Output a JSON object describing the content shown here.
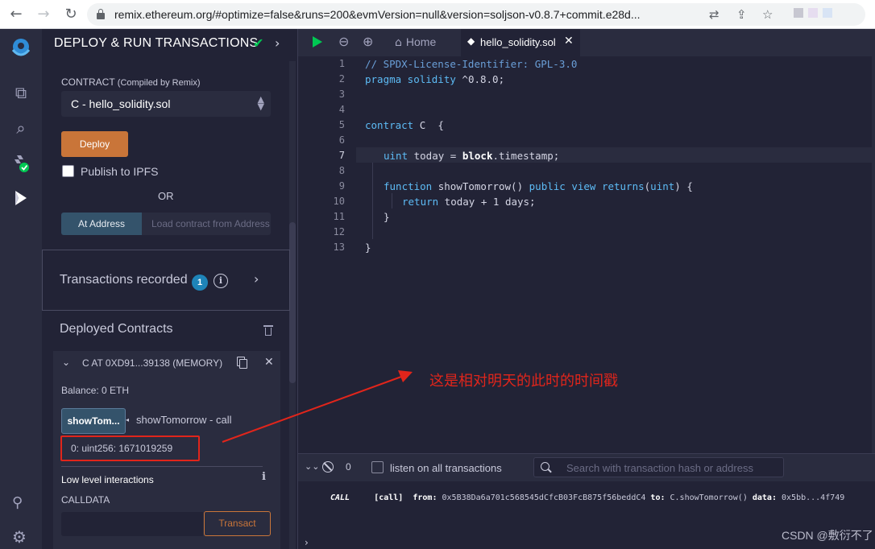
{
  "browser": {
    "url": "remix.ethereum.org/#optimize=false&runs=200&evmVersion=null&version=soljson-v0.8.7+commit.e28d..."
  },
  "panel": {
    "title": "DEPLOY & RUN TRANSACTIONS",
    "contract_label": "CONTRACT",
    "contract_sublabel": "(Compiled by Remix)",
    "contract_selected": "C - hello_solidity.sol",
    "deploy_label": "Deploy",
    "publish_label": "Publish to IPFS",
    "or_label": "OR",
    "at_address_label": "At Address",
    "at_address_placeholder": "Load contract from Address",
    "transactions_recorded_label": "Transactions recorded",
    "transactions_recorded_count": "1",
    "deployed_contracts_label": "Deployed Contracts",
    "instance": {
      "title": "C AT 0XD91...39138 (MEMORY)",
      "balance": "Balance: 0 ETH",
      "function_button": "showTom...",
      "function_label": "showTomorrow - call",
      "result": "0: uint256: 1671019259",
      "low_level_label": "Low level interactions",
      "calldata_label": "CALLDATA",
      "transact_label": "Transact"
    }
  },
  "editor": {
    "home_tab": "Home",
    "file_tab": "hello_solidity.sol",
    "lines": [
      {
        "n": "1"
      },
      {
        "n": "2"
      },
      {
        "n": "3"
      },
      {
        "n": "4"
      },
      {
        "n": "5"
      },
      {
        "n": "6"
      },
      {
        "n": "7"
      },
      {
        "n": "8"
      },
      {
        "n": "9"
      },
      {
        "n": "10"
      },
      {
        "n": "11"
      },
      {
        "n": "12"
      },
      {
        "n": "13"
      }
    ],
    "code": {
      "l1": "// SPDX-License-Identifier: GPL-3.0",
      "l2_kw": "pragma solidity",
      "l2_rest": " ^0.8.0;",
      "l5_kw": "contract",
      "l5_rest": " C  {",
      "l7_kw": "uint",
      "l7_mid": " today = ",
      "l7_bi": "block",
      "l7_rest": ".timestamp;",
      "l9_kw1": "function",
      "l9_mid1": " showTomorrow() ",
      "l9_kw2": "public view returns",
      "l9_mid2": "(",
      "l9_kw3": "uint",
      "l9_rest": ") {",
      "l10_kw": "return",
      "l10_rest": " today + 1 days;",
      "l11": "}",
      "l13": "}"
    }
  },
  "terminal": {
    "pending_count": "0",
    "listen_label": "listen on all transactions",
    "search_placeholder": "Search with transaction hash or address",
    "log_call": "CALL",
    "log_tag": "[call]",
    "log_from_label": "from:",
    "log_from": "0x5B38Da6a701c568545dCfcB03FcB875f56beddC4",
    "log_to_label": "to:",
    "log_to": "C.showTomorrow()",
    "log_data_label": "data:",
    "log_data": "0x5bb...4f749"
  },
  "annotation": {
    "text": "这是相对明天的此时的时间戳",
    "color": "#e1251b"
  },
  "watermark": "CSDN @敷衍不了",
  "colors": {
    "deploy": "#c97539",
    "accent_blue": "#34536b",
    "success": "#00c853"
  }
}
